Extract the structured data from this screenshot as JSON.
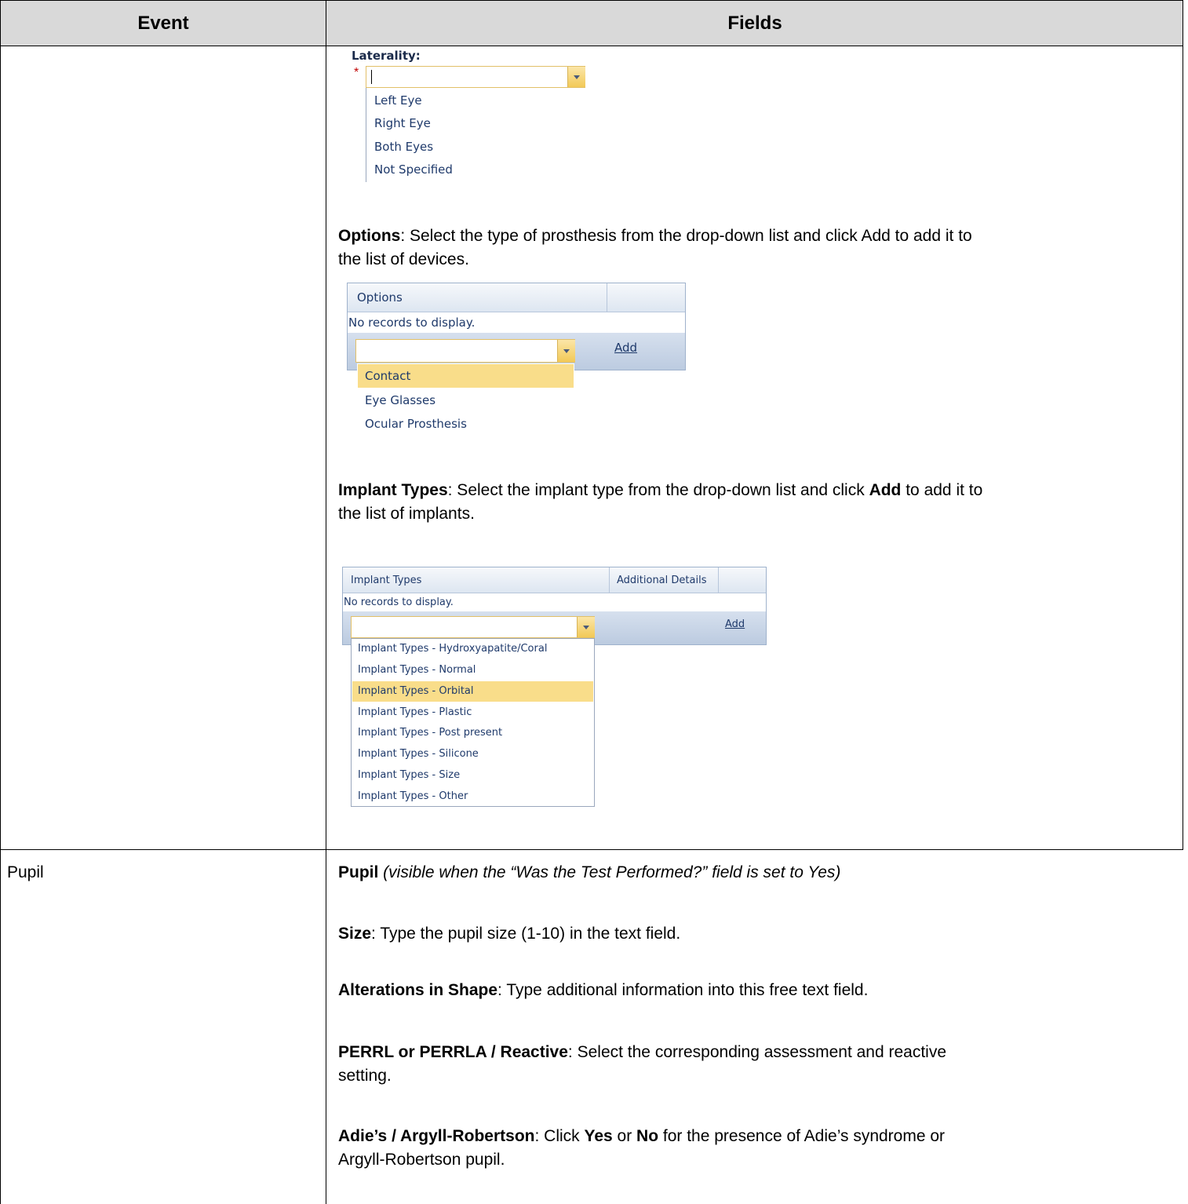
{
  "table": {
    "headers": {
      "event": "Event",
      "fields": "Fields"
    }
  },
  "laterality": {
    "label": "Laterality:",
    "required_marker": "*",
    "options": [
      "Left Eye",
      "Right Eye",
      "Both Eyes",
      "Not Specified"
    ]
  },
  "options_section": {
    "bold": "Options",
    "text_line1": ": Select the type of prosthesis from the drop-down list and click Add to add it to",
    "text_line2": "the list of devices.",
    "grid": {
      "header": "Options",
      "empty_text": "No records to display.",
      "add_label": "Add",
      "dropdown_items": [
        "Contact",
        "Eye Glasses",
        "Ocular Prosthesis"
      ],
      "highlighted": "Contact"
    }
  },
  "implant_section": {
    "bold": "Implant Types",
    "text_a": ": Select the implant type from the drop-down list and click ",
    "text_bold_add": "Add",
    "text_b": " to add it to",
    "text_line2": "the list of implants.",
    "grid": {
      "header_col1": "Implant Types",
      "header_col2": "Additional Details",
      "empty_text": "No records to display.",
      "add_label": "Add",
      "dropdown_items": [
        "Implant Types - Hydroxyapatite/Coral",
        "Implant Types - Normal",
        "Implant Types - Orbital",
        "Implant Types - Plastic",
        "Implant Types - Post present",
        "Implant Types - Silicone",
        "Implant Types - Size",
        "Implant Types - Other"
      ],
      "highlighted": "Implant Types - Orbital"
    }
  },
  "pupil_row": {
    "event": "Pupil",
    "title_bold": "Pupil",
    "title_italic": " (visible when the “Was the Test Performed?” field is set to Yes)",
    "size_bold": "Size",
    "size_text": ": Type the pupil size (1-10) in the text field.",
    "shape_bold": "Alterations in Shape",
    "shape_text": ": Type additional information into this free text field.",
    "perrl_bold": "PERRL or PERRLA / Reactive",
    "perrl_text_line1": ": Select the corresponding assessment and reactive",
    "perrl_text_line2": "setting.",
    "adie_bold": "Adie’s / Argyll-Robertson",
    "adie_text_a": ": Click ",
    "adie_yes": "Yes",
    "adie_text_b": " or ",
    "adie_no": "No",
    "adie_text_c": " for the presence of Adie’s syndrome or",
    "adie_text_line2": "Argyll-Robertson pupil."
  }
}
